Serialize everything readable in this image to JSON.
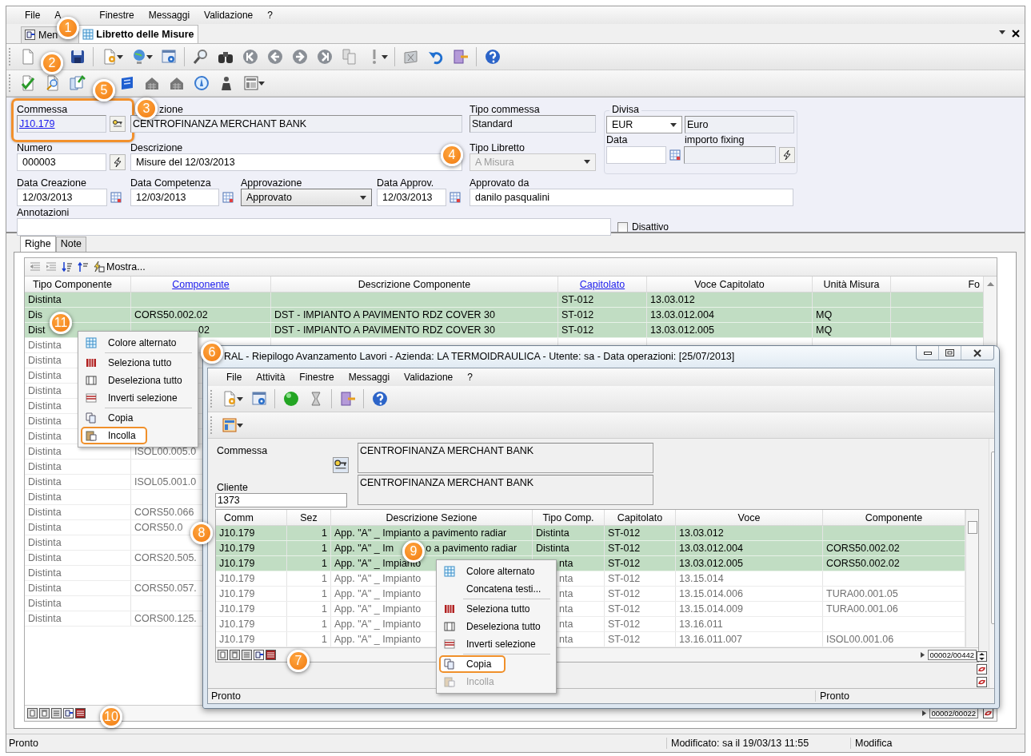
{
  "menu_bar": [
    "File",
    "A",
    "Finestre",
    "Messaggi",
    "Validazione",
    "?"
  ],
  "document_tabs": [
    {
      "label": "Men",
      "selected": false
    },
    {
      "label": "Libretto delle Misure",
      "selected": true
    }
  ],
  "form": {
    "commessa": {
      "label": "Commessa",
      "value": "J10.179",
      "highlighted": true
    },
    "descrizione_commessa": {
      "label": "zione",
      "value": "CENTROFINANZA MERCHANT BANK"
    },
    "tipo_commessa": {
      "label": "Tipo commessa",
      "value": "Standard"
    },
    "numero": {
      "label": "Numero",
      "value": "000003"
    },
    "descrizione": {
      "label": "Descrizione",
      "value": "Misure del 12/03/2013"
    },
    "tipo_libretto": {
      "label": "Tipo Libretto",
      "value": "A Misura",
      "disabled": true
    },
    "divisa": {
      "legend": "Divisa",
      "code": "EUR",
      "name": "Euro",
      "data_label": "Data",
      "fixing_label": "importo fixing"
    },
    "data_creazione": {
      "label": "Data Creazione",
      "value": "12/03/2013"
    },
    "data_competenza": {
      "label": "Data Competenza",
      "value": "12/03/2013"
    },
    "approvazione": {
      "label": "Approvazione",
      "value": "Approvato",
      "disabled": false
    },
    "data_approv": {
      "label": "Data Approv.",
      "value": "12/03/2013"
    },
    "approvato_da": {
      "label": "Approvato da",
      "value": "danilo pasqualini"
    },
    "annotazioni": {
      "label": "Annotazioni"
    },
    "disattivo": {
      "label": "Disattivo",
      "checked": false
    }
  },
  "subtabs": [
    {
      "label": "Righe",
      "selected": true
    },
    {
      "label": "Note",
      "selected": false
    }
  ],
  "grid": {
    "toolbar_button": "Mostra...",
    "columns": [
      {
        "label": "Tipo Componente",
        "link": false
      },
      {
        "label": "Componente",
        "link": true
      },
      {
        "label": "Descrizione Componente",
        "link": false
      },
      {
        "label": "Capitolato",
        "link": true
      },
      {
        "label": "Voce Capitolato",
        "link": false
      },
      {
        "label": "Unità Misura",
        "link": false
      },
      {
        "label": "Fo",
        "link": false
      }
    ],
    "rows": [
      {
        "selected": true,
        "tipo_componente": "Distinta",
        "capitolato": "ST-012",
        "voce_capitolato": "13.03.012"
      },
      {
        "selected": true,
        "tipo_componente": "Dis",
        "componente": "CORS50.002.02",
        "descrizione_componente": "DST - IMPIANTO A PAVIMENTO RDZ COVER 30",
        "capitolato": "ST-012",
        "voce_capitolato": "13.03.012.004",
        "unita_misura": "MQ"
      },
      {
        "selected": true,
        "tipo_componente": "Dist",
        "componente": "02",
        "descrizione_componente": "DST - IMPIANTO A PAVIMENTO RDZ COVER 30",
        "capitolato": "ST-012",
        "voce_capitolato": "13.03.012.005",
        "unita_misura": "MQ"
      },
      {
        "selected": false,
        "tipo_componente": "Distinta"
      },
      {
        "selected": false,
        "tipo_componente": "Distinta"
      },
      {
        "selected": false,
        "tipo_componente": "Distinta"
      },
      {
        "selected": false,
        "tipo_componente": "Distinta"
      },
      {
        "selected": false,
        "tipo_componente": "Distinta"
      },
      {
        "selected": false,
        "tipo_componente": "Distinta"
      },
      {
        "selected": false,
        "tipo_componente": "Distinta"
      },
      {
        "selected": false,
        "tipo_componente": "Distinta",
        "componente": "ISOL00.005.0"
      },
      {
        "selected": false,
        "tipo_componente": "Distinta"
      },
      {
        "selected": false,
        "tipo_componente": "Distinta",
        "componente": "ISOL05.001.0"
      },
      {
        "selected": false,
        "tipo_componente": "Distinta"
      },
      {
        "selected": false,
        "tipo_componente": "Distinta",
        "componente": "CORS50.066"
      },
      {
        "selected": false,
        "tipo_componente": "Distinta",
        "componente": "CORS50.0"
      },
      {
        "selected": false,
        "tipo_componente": "Distinta"
      },
      {
        "selected": false,
        "tipo_componente": "Distinta",
        "componente": "CORS20.505."
      },
      {
        "selected": false,
        "tipo_componente": "Distinta"
      },
      {
        "selected": false,
        "tipo_componente": "Distinta",
        "componente": "CORS50.057."
      },
      {
        "selected": false,
        "tipo_componente": "Distinta"
      },
      {
        "selected": false,
        "tipo_componente": "Distinta",
        "componente": "CORS00.125."
      }
    ],
    "pager": "00002/00022"
  },
  "status_bar": [
    "Pronto",
    "Modificato: sa il 19/03/13 11:55",
    "Modifica"
  ],
  "inner_window": {
    "title": "RAL - Riepilogo Avanzamento Lavori - Azienda: LA TERMOIDRAULICA - Utente: sa - Data operazioni: [25/07/2013]",
    "menu_bar": [
      "File",
      "Attività",
      "Finestre",
      "Messaggi",
      "Validazione",
      "?"
    ],
    "form": {
      "commessa_label": "Commessa",
      "commessa_description": "CENTROFINANZA MERCHANT BANK",
      "cliente_label": "Cliente",
      "cliente_value": "1373",
      "cliente_description": "CENTROFINANZA MERCHANT BANK"
    },
    "grid": {
      "columns": [
        {
          "label": "Comm",
          "link": false
        },
        {
          "label": "Sez",
          "link": false
        },
        {
          "label": "Descrizione Sezione",
          "link": false
        },
        {
          "label": "Tipo Comp.",
          "link": false
        },
        {
          "label": "Capitolato",
          "link": false
        },
        {
          "label": "Voce",
          "link": false
        },
        {
          "label": "Componente",
          "link": false
        }
      ],
      "rows": [
        {
          "selected": true,
          "comm": "J10.179",
          "sez": "1",
          "descrizione_sezione": "App. \"A\" _ Impianto a pavimento radiar",
          "tipo_comp": "Distinta",
          "capitolato": "ST-012",
          "voce": "13.03.012"
        },
        {
          "selected": true,
          "comm": "J10.179",
          "sez": "1",
          "descrizione_sezione": [
            "App. \"A\" _ Im",
            "o a pavimento radiar"
          ],
          "tipo_comp": "Distinta",
          "capitolato": "ST-012",
          "voce": "13.03.012.004",
          "componente": "CORS50.002.02"
        },
        {
          "selected": true,
          "comm": "J10.179",
          "sez": "1",
          "descrizione_sezione": "App. \"A\" _ Impianto",
          "tipo_comp": "nta",
          "capitolato": "ST-012",
          "voce": "13.03.012.005",
          "componente": "CORS50.002.02"
        },
        {
          "selected": false,
          "comm": "J10.179",
          "sez": "1",
          "descrizione_sezione": "App. \"A\" _ Impianto",
          "tipo_comp": "nta",
          "capitolato": "ST-012",
          "voce": "13.15.014"
        },
        {
          "selected": false,
          "comm": "J10.179",
          "sez": "1",
          "descrizione_sezione": "App. \"A\" _ Impianto",
          "tipo_comp": "nta",
          "capitolato": "ST-012",
          "voce": "13.15.014.006",
          "componente": "TURA00.001.05"
        },
        {
          "selected": false,
          "comm": "J10.179",
          "sez": "1",
          "descrizione_sezione": "App. \"A\" _ Impianto",
          "tipo_comp": "nta",
          "capitolato": "ST-012",
          "voce": "13.15.014.009",
          "componente": "TURA00.001.06"
        },
        {
          "selected": false,
          "comm": "J10.179",
          "sez": "1",
          "descrizione_sezione": "App. \"A\" _ Impianto",
          "tipo_comp": "nta",
          "capitolato": "ST-012",
          "voce": "13.16.011"
        },
        {
          "selected": false,
          "comm": "J10.179",
          "sez": "1",
          "descrizione_sezione": "App. \"A\" _ Impianto",
          "tipo_comp": "nta",
          "capitolato": "ST-012",
          "voce": "13.16.011.007",
          "componente": "ISOL00.001.06"
        }
      ],
      "pager": "00002/00442"
    },
    "status_bar": [
      "Pronto",
      "Pronto"
    ]
  },
  "context_menus": [
    {
      "items": [
        {
          "kind": "alternate-color",
          "label": "Colore alternato",
          "highlighted": false,
          "disabled": false
        },
        {
          "kind": "separator"
        },
        {
          "kind": "select-all",
          "label": "Seleziona tutto",
          "highlighted": false,
          "disabled": false
        },
        {
          "kind": "deselect-all",
          "label": "Deseleziona tutto",
          "highlighted": false,
          "disabled": false
        },
        {
          "kind": "invert",
          "label": "Inverti selezione",
          "highlighted": false,
          "disabled": false
        },
        {
          "kind": "separator"
        },
        {
          "kind": "copy",
          "label": "Copia",
          "highlighted": false,
          "disabled": false
        },
        {
          "kind": "paste",
          "label": "Incolla",
          "highlighted": true,
          "disabled": false
        }
      ]
    },
    {
      "items": [
        {
          "kind": "alternate-color",
          "label": "Colore alternato",
          "highlighted": false,
          "disabled": false
        },
        {
          "kind": "concatenate",
          "label": "Concatena testi...",
          "highlighted": false,
          "disabled": false
        },
        {
          "kind": "separator"
        },
        {
          "kind": "select-all",
          "label": "Seleziona tutto",
          "highlighted": false,
          "disabled": false
        },
        {
          "kind": "deselect-all",
          "label": "Deseleziona tutto",
          "highlighted": false,
          "disabled": false
        },
        {
          "kind": "invert",
          "label": "Inverti selezione",
          "highlighted": false,
          "disabled": false
        },
        {
          "kind": "separator"
        },
        {
          "kind": "copy",
          "label": "Copia",
          "highlighted": true,
          "disabled": false
        },
        {
          "kind": "paste",
          "label": "Incolla",
          "highlighted": false,
          "disabled": true
        }
      ]
    }
  ],
  "callouts": [
    {
      "number": "1"
    },
    {
      "number": "2"
    },
    {
      "number": "3"
    },
    {
      "number": "4"
    },
    {
      "number": "5"
    },
    {
      "number": "6"
    },
    {
      "number": "7"
    },
    {
      "number": "8"
    },
    {
      "number": "9"
    },
    {
      "number": "10"
    },
    {
      "number": "11"
    }
  ]
}
